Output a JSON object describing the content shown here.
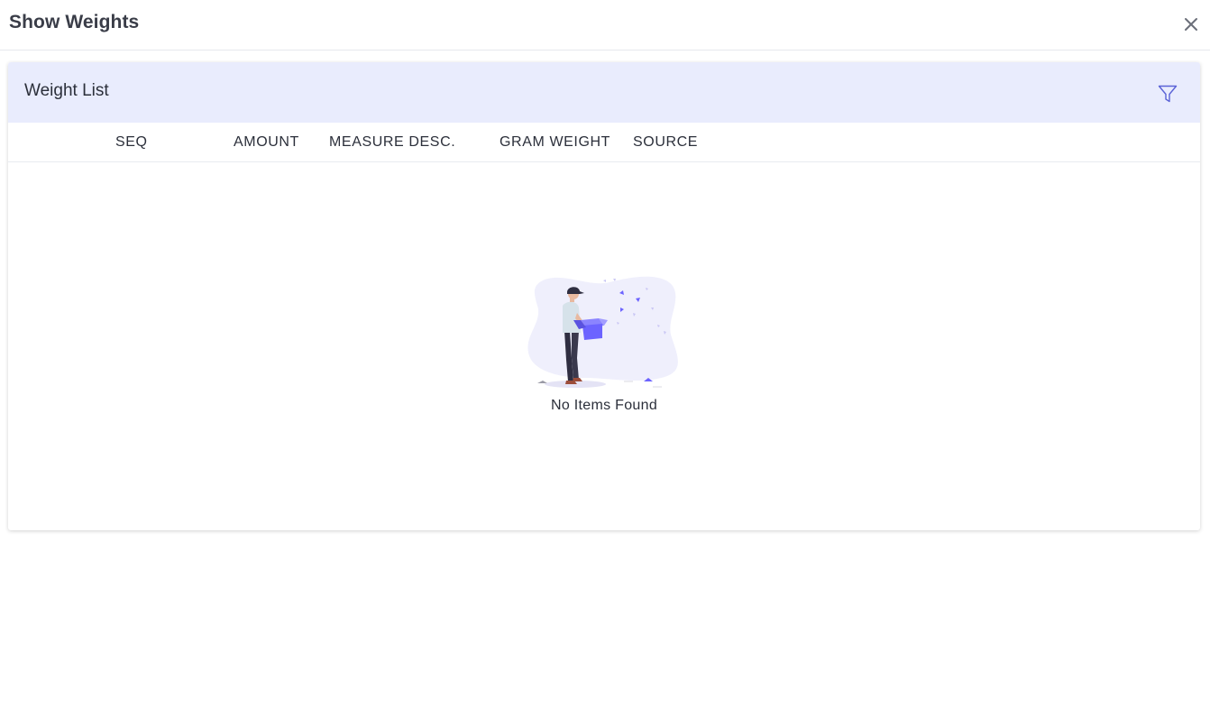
{
  "modal": {
    "title": "Show Weights",
    "close_icon": "close-icon"
  },
  "card": {
    "title": "Weight List",
    "filter_icon": "filter-icon"
  },
  "table": {
    "columns": [
      "SEQ",
      "AMOUNT",
      "MEASURE DESC.",
      "GRAM WEIGHT",
      "SOURCE"
    ],
    "rows": []
  },
  "empty_state": {
    "message": "No Items Found",
    "illustration": "person-holding-box-illustration"
  },
  "colors": {
    "card_header_bg": "#e9ecfd",
    "accent": "#6c63ff",
    "title_text": "#3a3d48"
  }
}
